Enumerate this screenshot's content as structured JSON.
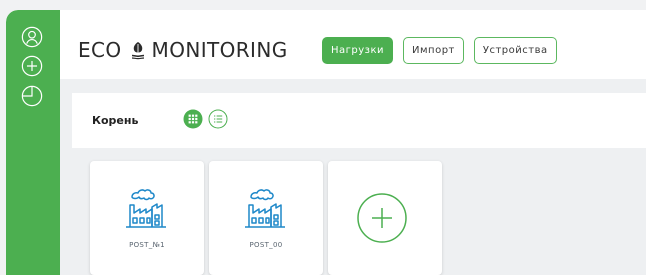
{
  "app": {
    "logo_left": "ECO",
    "logo_right": "MONITORING"
  },
  "nav": {
    "items": [
      {
        "label": "Нагрузки",
        "active": true
      },
      {
        "label": "Импорт",
        "active": false
      },
      {
        "label": "Устройства",
        "active": false
      }
    ]
  },
  "sidebar": {
    "icons": [
      "user-icon",
      "add-circle-icon",
      "pie-chart-icon"
    ]
  },
  "breadcrumb": {
    "root_label": "Корень"
  },
  "view_toggle": {
    "grid_icon": "grid-view-icon",
    "list_icon": "list-view-icon",
    "selected": "grid"
  },
  "tiles": [
    {
      "label": "POST_№1",
      "icon": "factory-icon"
    },
    {
      "label": "POST_00",
      "icon": "factory-icon"
    }
  ],
  "add_tile": {
    "icon": "plus-circle-icon"
  },
  "colors": {
    "accent": "#4caf50",
    "icon_blue": "#1e88c9",
    "background": "#eef0f2"
  }
}
